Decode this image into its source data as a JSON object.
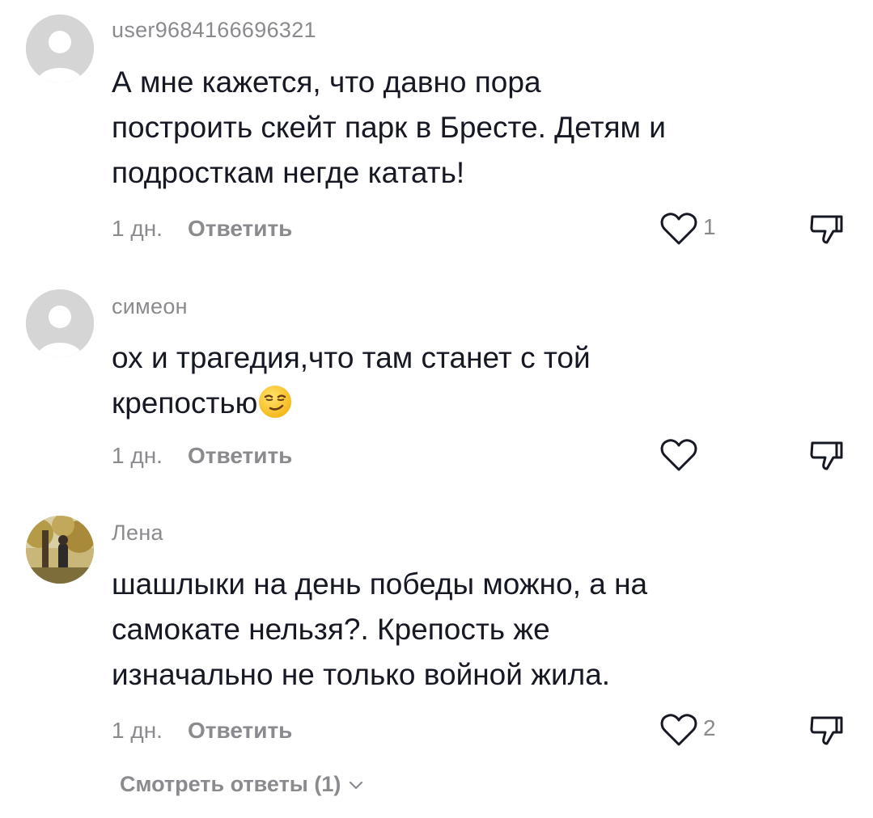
{
  "comments": [
    {
      "username": "user9684166696321",
      "text_lines": [
        "А мне кажется, что давно пора",
        "построить скейт парк в Бресте. Детям и",
        "подросткам негде катать!"
      ],
      "time": "1 дн.",
      "reply_label": "Ответить",
      "like_count": "1",
      "avatar": "default-avatar"
    },
    {
      "username": "симеон",
      "text_lines": [
        "ох и трагедия,что там станет с той",
        "крепостью"
      ],
      "emoji": "smirking-face",
      "time": "1 дн.",
      "reply_label": "Ответить",
      "like_count": "",
      "avatar": "default-avatar"
    },
    {
      "username": "Лена",
      "text_lines": [
        "шашлыки на день победы можно, а на",
        "самокате нельзя?. Крепость же",
        "изначально не только войной жила."
      ],
      "time": "1 дн.",
      "reply_label": "Ответить",
      "like_count": "2",
      "avatar": "photo-avatar"
    }
  ],
  "view_replies_label": "Смотреть ответы (1)",
  "icons": {
    "like": "heart-icon",
    "dislike": "thumbs-down-icon",
    "expand": "chevron-down-icon"
  },
  "colors": {
    "text": "#161823",
    "muted": "#8a8a8f",
    "avatar_placeholder": "#d5d5d5"
  }
}
